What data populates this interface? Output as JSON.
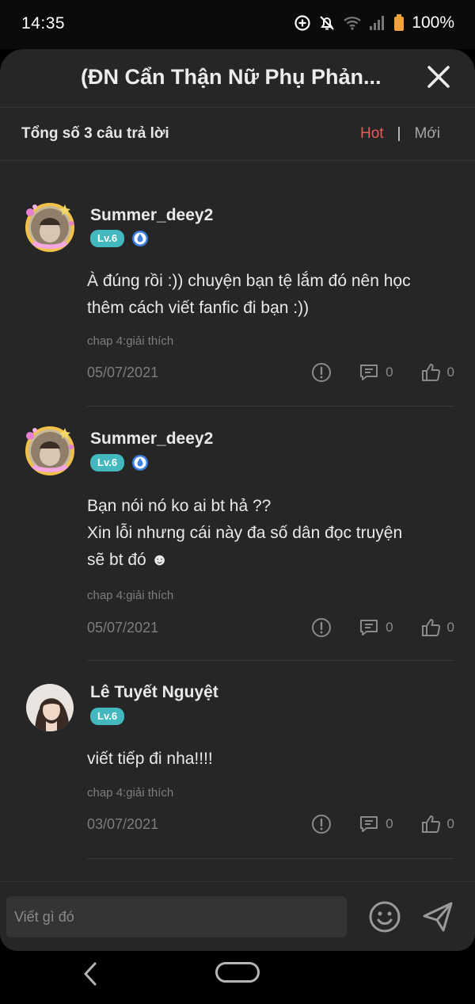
{
  "status_bar": {
    "time": "14:35",
    "battery": "100%",
    "icons": [
      "data-saver-icon",
      "mute-bell-icon",
      "wifi-icon",
      "signal-icon",
      "battery-icon"
    ]
  },
  "header": {
    "title": "(ĐN Cẩn Thận Nữ Phụ Phản..."
  },
  "subheader": {
    "total": "Tổng số 3 câu trả lời",
    "sort_hot": "Hot",
    "sort_separator": "|",
    "sort_new": "Mới",
    "colors": {
      "hot": "#e95b5b"
    }
  },
  "comments": [
    {
      "username": "Summer_deey2",
      "level": "Lv.6",
      "text_lines": [
        "À đúng rồi :)) chuyện bạn tệ lắm đó nên học",
        "thêm cách viết fanfic đi bạn :))"
      ],
      "chapter": "chap 4:giải thích",
      "date": "05/07/2021",
      "comment_count": "0",
      "like_count": "0"
    },
    {
      "username": "Summer_deey2",
      "level": "Lv.6",
      "text_lines": [
        "Bạn nói nó ko ai bt hả ??",
        "Xin lỗi nhưng cái này đa số dân đọc truyện",
        "sẽ bt đó ☻"
      ],
      "chapter": "chap 4:giải thích",
      "date": "05/07/2021",
      "comment_count": "0",
      "like_count": "0"
    },
    {
      "username": "Lê Tuyết Nguyệt",
      "level": "Lv.6",
      "text_lines": [
        "viết tiếp đi nha!!!!"
      ],
      "chapter": "chap 4:giải thích",
      "date": "03/07/2021",
      "comment_count": "0",
      "like_count": "0"
    }
  ],
  "footer": {
    "input_placeholder": "Viết gì đó"
  },
  "colors": {
    "level_badge": "#43b8bf",
    "sheet_bg": "#262626"
  }
}
